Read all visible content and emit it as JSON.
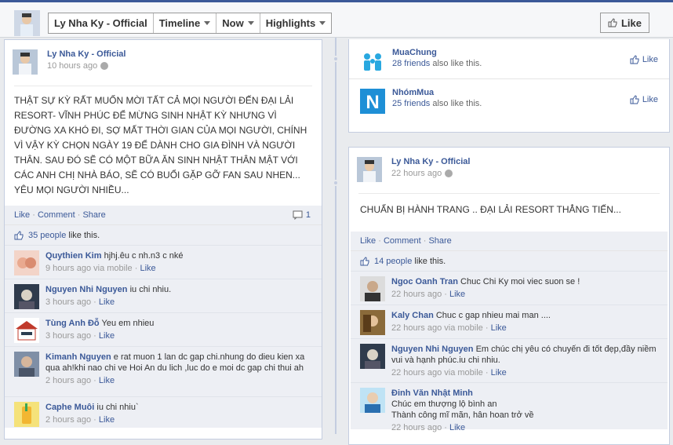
{
  "header": {
    "page_name": "Ly Nha Ky - Official",
    "nav": [
      "Timeline",
      "Now",
      "Highlights"
    ],
    "like_button": "Like"
  },
  "left_post": {
    "author": "Ly Nha Ky - Official",
    "time": "10 hours ago",
    "text": "THẬT SỰ KỲ RẤT MUỐN MỜI TẤT CẢ MỌI NGƯỜI ĐẾN ĐẠI LẢI RESORT- VĨNH PHÚC ĐỂ MỪNG SINH NHẬT KỲ NHƯNG VÌ ĐƯỜNG XA KHÓ ĐI, SỢ MẤT THỜI GIAN CỦA MỌI NGƯỜI, CHÍNH VÌ VẬY KỲ CHỌN NGÀY 19 ĐỂ DÀNH CHO GIA ĐÌNH VÀ NGƯỜI THÂN. SAU ĐÓ SẼ CÓ MỘT BỮA ĂN SINH NHẬT THÂN MẬT VỚI CÁC ANH CHỊ NHÀ BÁO, SẼ CÓ BUỔI GẶP GỠ FAN SAU NHEN... YÊU MỌI NGƯỜI NHIỀU...",
    "actions": {
      "like": "Like",
      "comment": "Comment",
      "share": "Share",
      "comment_count": "1"
    },
    "likes_count": "35 people",
    "likes_suffix": "like this.",
    "comments": [
      {
        "name": "Quythien Kim",
        "text": "hjhj.êu c nh.n3 c nké",
        "meta": "9 hours ago via mobile",
        "like": "Like"
      },
      {
        "name": "Nguyen Nhi Nguyen",
        "text": "iu chi nhiu.",
        "meta": "3 hours ago",
        "like": "Like"
      },
      {
        "name": "Tùng Anh Đỗ",
        "text": "Yeu em nhieu",
        "meta": "3 hours ago",
        "like": "Like"
      },
      {
        "name": "Kimanh Nguyen",
        "text": "e rat muon 1 lan dc gap chi.nhung do dieu kien xa qua ah!khi nao chi ve Hoi An du lich ,luc do e moi dc gap chi thui ah",
        "meta": "2 hours ago",
        "like": "Like"
      },
      {
        "name": "Caphe Muôi",
        "text": "iu chi nhiu`",
        "meta": "2 hours ago",
        "like": "Like"
      }
    ]
  },
  "right_pages": [
    {
      "name": "MuaChung",
      "friends": "28 friends",
      "suffix": "also like this.",
      "like": "Like"
    },
    {
      "name": "NhómMua",
      "friends": "25 friends",
      "suffix": "also like this.",
      "like": "Like"
    }
  ],
  "right_post": {
    "author": "Ly Nha Ky - Official",
    "time": "22 hours ago",
    "text": "CHUẨN BỊ HÀNH TRANG .. ĐẠI LẢI RESORT THẲNG TIẾN...",
    "actions": {
      "like": "Like",
      "comment": "Comment",
      "share": "Share"
    },
    "likes_count": "14 people",
    "likes_suffix": "like this.",
    "comments": [
      {
        "name": "Ngoc Oanh Tran",
        "text": "Chuc Chi Ky moi viec suon se !",
        "meta": "22 hours ago",
        "like": "Like"
      },
      {
        "name": "Kaly Chan",
        "text": "Chuc c gap nhieu mai man ....",
        "meta": "22 hours ago via mobile",
        "like": "Like"
      },
      {
        "name": "Nguyen Nhi Nguyen",
        "text": "Em chúc chị yêu có chuyến đi tốt đẹp,đầy niềm vui và hạnh phúc.iu chi nhiu.",
        "meta": "22 hours ago via mobile",
        "like": "Like"
      },
      {
        "name": "Đinh Văn Nhật Minh",
        "text": "Chúc em thượng lộ bình an\nThành công mĩ mãn, hân hoan trở về",
        "meta": "22 hours ago",
        "like": "Like"
      }
    ]
  }
}
